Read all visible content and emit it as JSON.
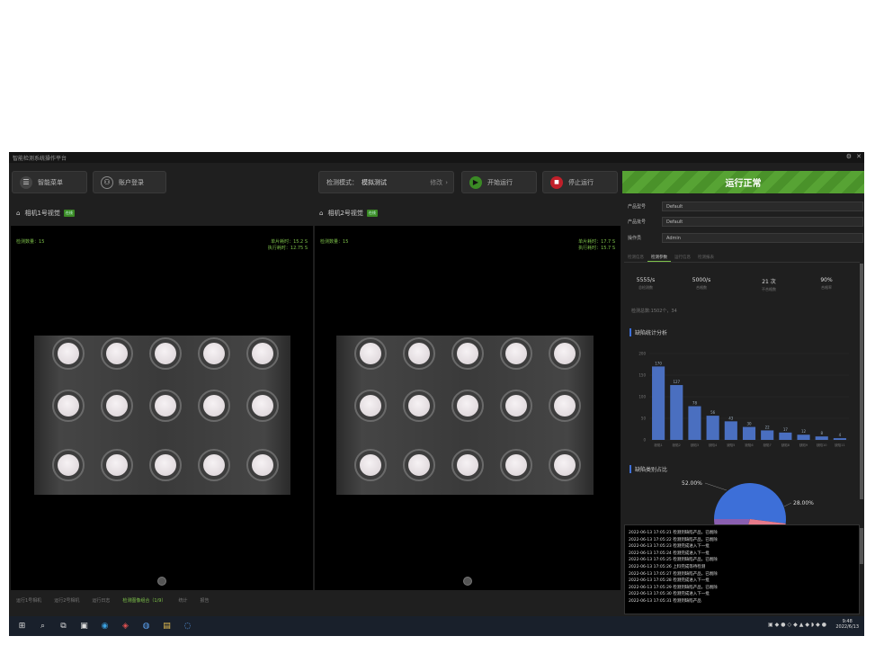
{
  "window": {
    "title": "智能检测系统操作平台"
  },
  "toolbar": {
    "menu_label": "智能菜单",
    "user_label": "账户登录",
    "mode_label": "检测模式：",
    "mode_value": "模拟测试",
    "mode_action": "修改",
    "start_label": "开始运行",
    "stop_label": "停止运行"
  },
  "status": {
    "text": "运行正常",
    "color": "#57a334"
  },
  "cameras": [
    {
      "title": "相机1号视觉",
      "badge": "在线",
      "count_label": "检测数量：",
      "count": "15",
      "s1_label": "单片耗时：",
      "s1_val": "15.2 S",
      "s2_label": "执行耗时：",
      "s2_val": "12.75 S"
    },
    {
      "title": "相机2号视觉",
      "badge": "在线",
      "count_label": "检测数量：",
      "count": "15",
      "s1_label": "单片耗时：",
      "s1_val": "17.7 S",
      "s2_label": "执行耗时：",
      "s2_val": "15.7 S"
    }
  ],
  "bottom_tabs": [
    "运行1号相机",
    "运行2号相机",
    "运行日志",
    "检测图像组合（1/9）",
    "统计",
    "报告"
  ],
  "form": {
    "f1_label": "产品型号",
    "f1_value": "Default",
    "f2_label": "产品批号",
    "f2_value": "Default",
    "f3_label": "操作员",
    "f3_value": "Admin"
  },
  "right_tabs": [
    "检测信息",
    "检测参数",
    "运行信息",
    "检测报表"
  ],
  "kpis": [
    {
      "value": "5555/s",
      "label": "总检测数"
    },
    {
      "value": "5000/s",
      "label": "合格数"
    },
    {
      "value": "21 次",
      "label": "不合格数"
    },
    {
      "value": "90%",
      "label": "合格率"
    }
  ],
  "summary_text": "检测总数:1502个，34",
  "bar_section_title": "缺陷统计分析",
  "pie_section_title": "缺陷类别占比",
  "chart_data": [
    {
      "type": "bar",
      "categories": [
        "缺陷1",
        "缺陷2",
        "缺陷3",
        "缺陷4",
        "缺陷5",
        "缺陷6",
        "缺陷7",
        "缺陷8",
        "缺陷9",
        "缺陷10",
        "缺陷11"
      ],
      "values": [
        170,
        127,
        78,
        56,
        43,
        30,
        22,
        17,
        12,
        8,
        4
      ],
      "ylim": [
        0,
        200
      ],
      "ticks": [
        0,
        50,
        100,
        150,
        200
      ],
      "color": "#4a6fc0"
    },
    {
      "type": "pie",
      "labels": [
        "",
        "",
        ""
      ],
      "values": [
        52.0,
        28.0,
        20.0
      ],
      "data_labels": [
        "52.00%",
        "28.00%"
      ],
      "colors": [
        "#3d6fd8",
        "#e67a8a",
        "#8a5fb0"
      ]
    }
  ],
  "log": [
    "2022-06-13 17:05:21 检测到缺陷产品，已剔除",
    "2022-06-13 17:05:22 检测到缺陷产品，已剔除",
    "2022-06-13 17:05:23 检测完成进入下一批",
    "2022-06-13 17:05:24 检测完成进入下一批",
    "2022-06-13 17:05:25 检测到缺陷产品，已剔除",
    "2022-06-13 17:05:26 上料完成等待检测",
    "2022-06-13 17:05:27 检测到缺陷产品，已剔除",
    "2022-06-13 17:05:28 检测完成进入下一批",
    "2022-06-13 17:05:29 检测到缺陷产品，已剔除",
    "2022-06-13 17:05:30 检测完成进入下一批",
    "2022-06-13 17:05:31 检测到缺陷产品"
  ],
  "taskbar": {
    "time": "9:48",
    "date": "2022/6/13"
  }
}
